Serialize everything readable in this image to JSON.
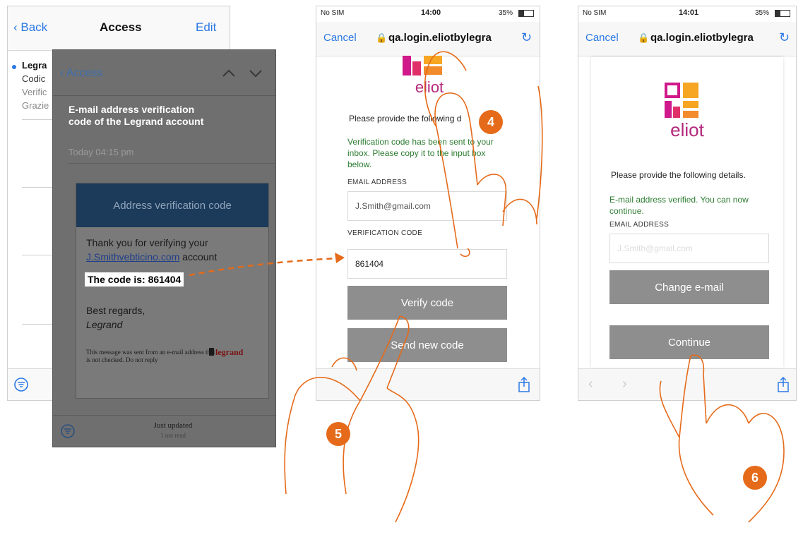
{
  "mail_list": {
    "back_label": "Back",
    "title": "Access",
    "edit_label": "Edit",
    "preview": {
      "sender": "Legra",
      "line1": "Codic",
      "line2": "Verific",
      "line3": "Grazie"
    }
  },
  "message": {
    "back_label": "Access",
    "subject": "E-mail address verification code of the Legrand account",
    "date": "Today 04:15 pm",
    "banner": "Address verification code",
    "thanks": "Thank you for verifying your",
    "email_link": "J.Smithvebticino.com",
    "account_word": "account",
    "code_text": "The code is: 861404",
    "regards": "Best regards,",
    "signature": "Legrand",
    "footer_note": "This message was sent from an e-mail address that is not checked. Do not reply",
    "brand": "legrand",
    "bottom_status": "Just updated",
    "bottom_sub": "1 not read"
  },
  "phone1": {
    "carrier": "No SIM",
    "time": "14:00",
    "battery": "35%",
    "cancel": "Cancel",
    "url": "qa.login.eliotbylegra",
    "logo": "eliot",
    "intro": "Please provide the following d",
    "notice": "Verification code has been sent to your inbox. Please copy it to the input box below.",
    "email_label": "EMAIL ADDRESS",
    "email_value": "J.Smith@gmail.com",
    "code_label": "VERIFICATION CODE",
    "code_value": "861404",
    "verify_button": "Verify code",
    "send_button": "Send new code"
  },
  "phone2": {
    "carrier": "No SIM",
    "time": "14:01",
    "battery": "35%",
    "cancel": "Cancel",
    "url": "qa.login.eliotbylegra",
    "logo": "eliot",
    "intro": "Please provide the following details.",
    "notice": "E-mail address verified. You can now continue.",
    "email_label": "EMAIL ADDRESS",
    "email_value": "J.Smith@gmail.com",
    "change_button": "Change e-mail",
    "continue_button": "Continue"
  },
  "steps": {
    "four": "4",
    "five": "5",
    "six": "6"
  },
  "colors": {
    "ios_blue": "#2b78e4",
    "step_orange": "#e56a19",
    "banner_navy": "#1c3a5a",
    "verified_green": "#2e7d32"
  }
}
